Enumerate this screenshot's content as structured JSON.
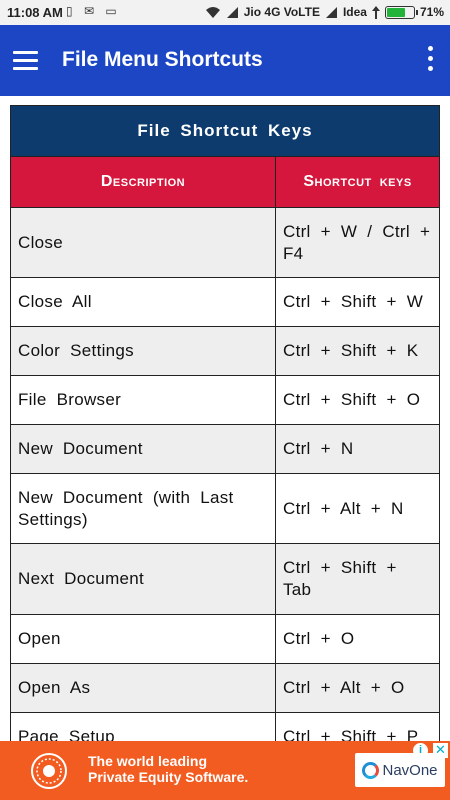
{
  "status_bar": {
    "time": "11:08 AM",
    "left_icons": "▯ ✉ ▭",
    "carrier1": "Jio 4G VoLTE",
    "carrier2": "Idea",
    "battery_text": "71%",
    "battery_level": 0.71,
    "battery_color": "#21b33a"
  },
  "app_bar": {
    "title": "File Menu Shortcuts",
    "color": "#1c46c4"
  },
  "table": {
    "title": "File Shortcut Keys",
    "headers": {
      "description": "Description",
      "shortcut": "Shortcut keys"
    },
    "title_color": "#0d3b6e",
    "header_color": "#d6173d",
    "rows": [
      {
        "description": "Close",
        "shortcut": "Ctrl + W / Ctrl + F4"
      },
      {
        "description": "Close All",
        "shortcut": "Ctrl + Shift + W"
      },
      {
        "description": "Color Settings",
        "shortcut": "Ctrl + Shift + K"
      },
      {
        "description": "File Browser",
        "shortcut": "Ctrl + Shift + O"
      },
      {
        "description": "New Document",
        "shortcut": "Ctrl + N"
      },
      {
        "description": "New Document (with Last Settings)",
        "shortcut": "Ctrl + Alt + N"
      },
      {
        "description": "Next Document",
        "shortcut": "Ctrl + Shift + Tab"
      },
      {
        "description": "Open",
        "shortcut": "Ctrl + O"
      },
      {
        "description": "Open As",
        "shortcut": "Ctrl + Alt + O"
      },
      {
        "description": "Page Setup",
        "shortcut": "Ctrl + Shift + P"
      }
    ]
  },
  "ad": {
    "line1": "The world leading",
    "line2": "Private Equity Software.",
    "cta": "NavOne",
    "info": "i",
    "close": "✕",
    "color": "#f25c21"
  }
}
